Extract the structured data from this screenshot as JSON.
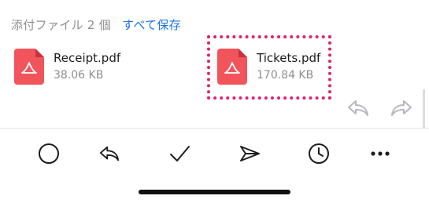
{
  "attachments_header": {
    "count_label": "添付ファイル 2 個",
    "save_all_label": "すべて保存"
  },
  "attachments": [
    {
      "name": "Receipt.pdf",
      "size": "38.06 KB",
      "icon": "pdf-file-icon"
    },
    {
      "name": "Tickets.pdf",
      "size": "170.84 KB",
      "icon": "pdf-file-icon"
    }
  ],
  "message_actions": [
    {
      "icon": "reply-icon"
    },
    {
      "icon": "forward-icon"
    }
  ],
  "toolbar": {
    "items": [
      {
        "icon": "circle-icon"
      },
      {
        "icon": "reply-icon"
      },
      {
        "icon": "checkmark-icon"
      },
      {
        "icon": "send-icon"
      },
      {
        "icon": "clock-icon"
      },
      {
        "icon": "more-icon"
      }
    ]
  },
  "colors": {
    "accent_blue": "#1a73e8",
    "pdf_red": "#f2545b",
    "highlight_pink": "#e0206b",
    "secondary_text": "#8e8e93",
    "muted_icon": "#b7b7bc"
  }
}
